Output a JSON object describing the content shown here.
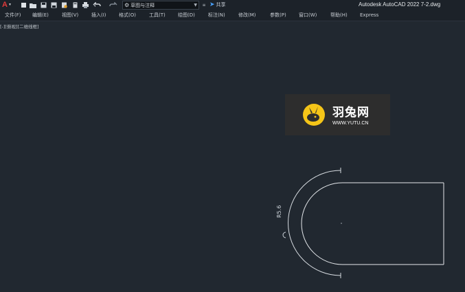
{
  "window": {
    "app_title": "Autodesk AutoCAD 2022   7-2.dwg"
  },
  "toolbar": {
    "logo": "A",
    "workspace": "草图与注释",
    "share": "共享"
  },
  "menu": [
    {
      "label": "文件(F)"
    },
    {
      "label": "编辑(E)"
    },
    {
      "label": "视图(V)"
    },
    {
      "label": "插入(I)"
    },
    {
      "label": "格式(O)"
    },
    {
      "label": "工具(T)"
    },
    {
      "label": "绘图(D)"
    },
    {
      "label": "标注(N)"
    },
    {
      "label": "修改(M)"
    },
    {
      "label": "参数(P)"
    },
    {
      "label": "窗口(W)"
    },
    {
      "label": "帮助(H)"
    },
    {
      "label": "Express"
    }
  ],
  "viewport": {
    "label": "[-][俯视][二维线框]"
  },
  "watermark": {
    "name_cn": "羽兔网",
    "url": "WWW.YUTU.CN",
    "color": "#f5c518"
  },
  "drawing": {
    "dimension_text": "R5.6",
    "line_color": "#e6e9ec"
  }
}
